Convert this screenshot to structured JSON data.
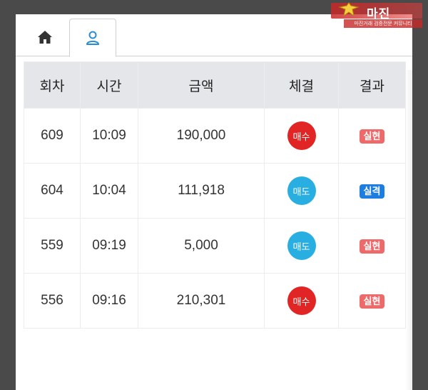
{
  "logo": {
    "name": "마진",
    "tagline": "마진거래 검증전문 커뮤니티"
  },
  "tabs": [
    {
      "icon": "home-icon",
      "active": false
    },
    {
      "icon": "user-icon",
      "active": true
    }
  ],
  "table": {
    "headers": [
      "회차",
      "시간",
      "금액",
      "체결",
      "결과"
    ],
    "rows": [
      {
        "round": "609",
        "time": "10:09",
        "amount": "190,000",
        "trade": "매수",
        "trade_type": "buy",
        "result": "실현",
        "result_type": "hit"
      },
      {
        "round": "604",
        "time": "10:04",
        "amount": "111,918",
        "trade": "매도",
        "trade_type": "sell",
        "result": "실격",
        "result_type": "miss"
      },
      {
        "round": "559",
        "time": "09:19",
        "amount": "5,000",
        "trade": "매도",
        "trade_type": "sell",
        "result": "실현",
        "result_type": "hit"
      },
      {
        "round": "556",
        "time": "09:16",
        "amount": "210,301",
        "trade": "매수",
        "trade_type": "buy",
        "result": "실현",
        "result_type": "hit"
      }
    ]
  },
  "colors": {
    "buy": "#e12424",
    "sell": "#29aee2",
    "hit": "#ee6a6a",
    "miss": "#1e7ee0",
    "header_bg": "#e4e6e9"
  }
}
